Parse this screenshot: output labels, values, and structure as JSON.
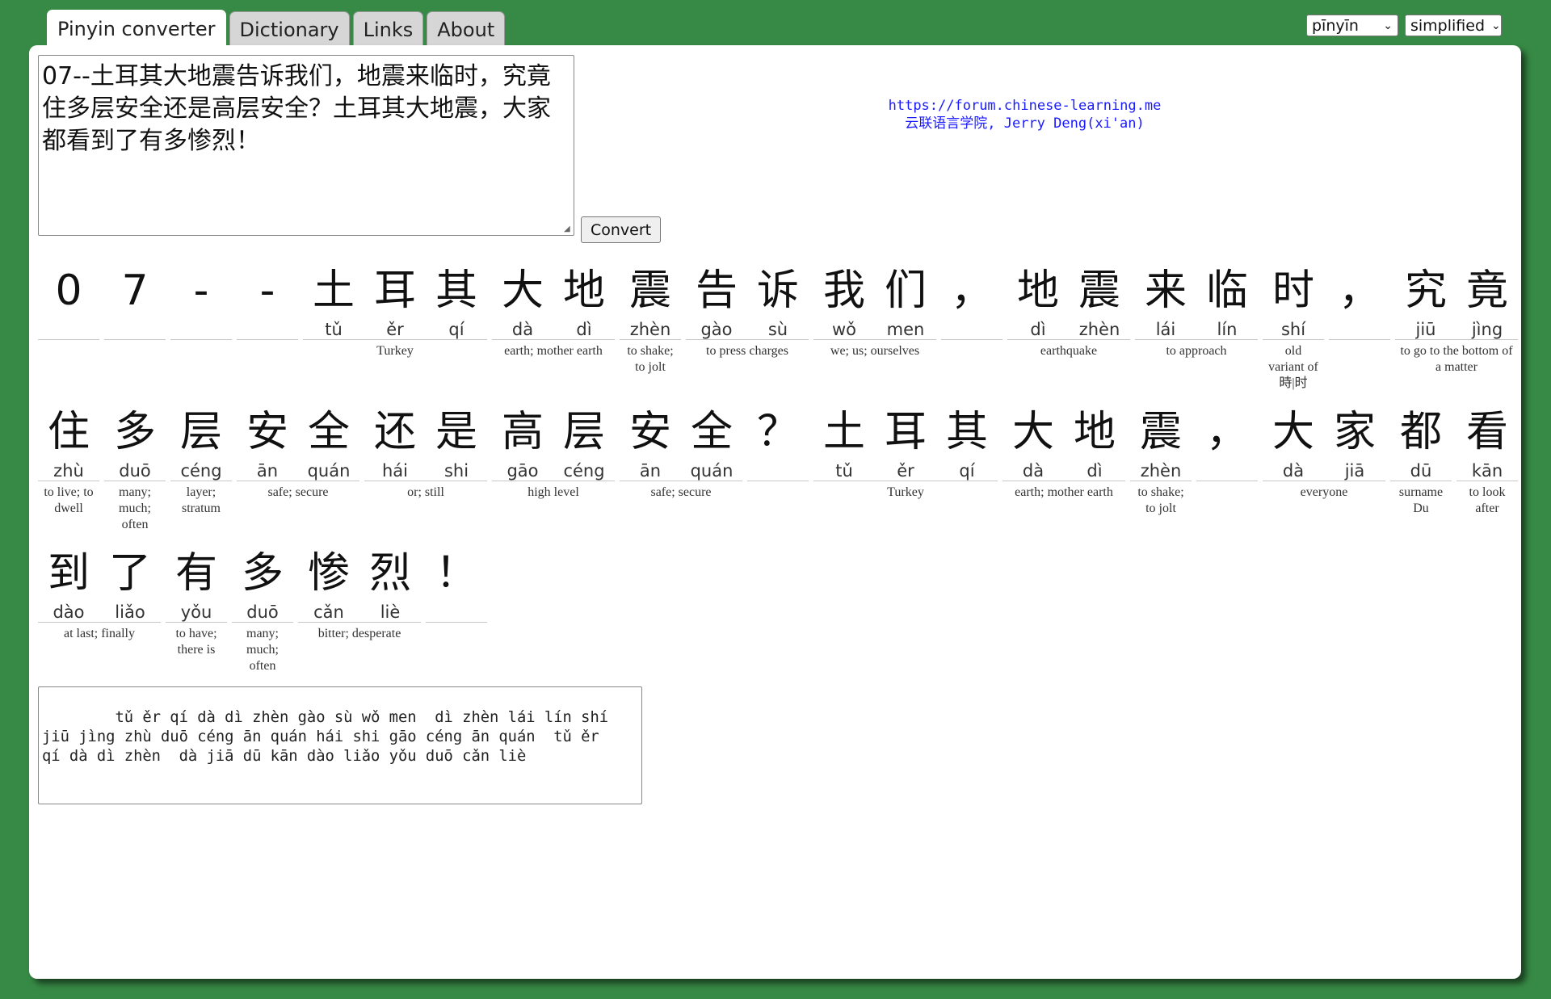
{
  "tabs": [
    {
      "label": "Pinyin converter",
      "active": true
    },
    {
      "label": "Dictionary",
      "active": false
    },
    {
      "label": "Links",
      "active": false
    },
    {
      "label": "About",
      "active": false
    }
  ],
  "selects": {
    "tone_style": "pīnyīn",
    "script": "simplified"
  },
  "input_text": "07--土耳其大地震告诉我们，地震来临时，究竟住多层安全还是高层安全？土耳其大地震，大家都看到了有多惨烈！",
  "convert_label": "Convert",
  "credit": {
    "url": "https://forum.chinese-learning.me",
    "author": "云联语言学院, Jerry Deng(xi'an)"
  },
  "rows": [
    [
      {
        "chars": [
          [
            "0",
            ""
          ]
        ],
        "def": ""
      },
      {
        "chars": [
          [
            "7",
            ""
          ]
        ],
        "def": ""
      },
      {
        "chars": [
          [
            "-",
            ""
          ]
        ],
        "def": ""
      },
      {
        "chars": [
          [
            "-",
            ""
          ]
        ],
        "def": ""
      },
      {
        "chars": [
          [
            "土",
            "tǔ"
          ],
          [
            "耳",
            "ěr"
          ],
          [
            "其",
            "qí"
          ]
        ],
        "def": "Turkey"
      },
      {
        "chars": [
          [
            "大",
            "dà"
          ],
          [
            "地",
            "dì"
          ]
        ],
        "def": "earth; mother earth"
      },
      {
        "chars": [
          [
            "震",
            "zhèn"
          ]
        ],
        "def": "to shake; to jolt"
      },
      {
        "chars": [
          [
            "告",
            "gào"
          ],
          [
            "诉",
            "sù"
          ]
        ],
        "def": "to press charges"
      },
      {
        "chars": [
          [
            "我",
            "wǒ"
          ],
          [
            "们",
            "men"
          ]
        ],
        "def": "we; us; ourselves"
      },
      {
        "chars": [
          [
            "，",
            ""
          ]
        ],
        "def": ""
      },
      {
        "chars": [
          [
            "地",
            "dì"
          ],
          [
            "震",
            "zhèn"
          ]
        ],
        "def": "earthquake"
      },
      {
        "chars": [
          [
            "来",
            "lái"
          ],
          [
            "临",
            "lín"
          ]
        ],
        "def": "to approach"
      },
      {
        "chars": [
          [
            "时",
            "shí"
          ]
        ],
        "def": "old variant of 時|时"
      },
      {
        "chars": [
          [
            "，",
            ""
          ]
        ],
        "def": ""
      },
      {
        "chars": [
          [
            "究",
            "jiū"
          ],
          [
            "竟",
            "jìng"
          ]
        ],
        "def": "to go to the bottom of a matter"
      }
    ],
    [
      {
        "chars": [
          [
            "住",
            "zhù"
          ]
        ],
        "def": "to live; to dwell"
      },
      {
        "chars": [
          [
            "多",
            "duō"
          ]
        ],
        "def": "many; much; often"
      },
      {
        "chars": [
          [
            "层",
            "céng"
          ]
        ],
        "def": "layer; stratum"
      },
      {
        "chars": [
          [
            "安",
            "ān"
          ],
          [
            "全",
            "quán"
          ]
        ],
        "def": "safe; secure"
      },
      {
        "chars": [
          [
            "还",
            "hái"
          ],
          [
            "是",
            "shi"
          ]
        ],
        "def": "or; still"
      },
      {
        "chars": [
          [
            "高",
            "gāo"
          ],
          [
            "层",
            "céng"
          ]
        ],
        "def": "high level"
      },
      {
        "chars": [
          [
            "安",
            "ān"
          ],
          [
            "全",
            "quán"
          ]
        ],
        "def": "safe; secure"
      },
      {
        "chars": [
          [
            "？",
            ""
          ]
        ],
        "def": ""
      },
      {
        "chars": [
          [
            "土",
            "tǔ"
          ],
          [
            "耳",
            "ěr"
          ],
          [
            "其",
            "qí"
          ]
        ],
        "def": "Turkey"
      },
      {
        "chars": [
          [
            "大",
            "dà"
          ],
          [
            "地",
            "dì"
          ]
        ],
        "def": "earth; mother earth"
      },
      {
        "chars": [
          [
            "震",
            "zhèn"
          ]
        ],
        "def": "to shake; to jolt"
      },
      {
        "chars": [
          [
            "，",
            ""
          ]
        ],
        "def": ""
      },
      {
        "chars": [
          [
            "大",
            "dà"
          ],
          [
            "家",
            "jiā"
          ]
        ],
        "def": "everyone"
      },
      {
        "chars": [
          [
            "都",
            "dū"
          ]
        ],
        "def": "surname Du"
      },
      {
        "chars": [
          [
            "看",
            "kān"
          ]
        ],
        "def": "to look after"
      }
    ],
    [
      {
        "chars": [
          [
            "到",
            "dào"
          ],
          [
            "了",
            "liǎo"
          ]
        ],
        "def": "at last; finally"
      },
      {
        "chars": [
          [
            "有",
            "yǒu"
          ]
        ],
        "def": "to have; there is"
      },
      {
        "chars": [
          [
            "多",
            "duō"
          ]
        ],
        "def": "many; much; often"
      },
      {
        "chars": [
          [
            "惨",
            "cǎn"
          ],
          [
            "烈",
            "liè"
          ]
        ],
        "def": "bitter; desperate"
      },
      {
        "chars": [
          [
            "！",
            ""
          ]
        ],
        "def": ""
      }
    ]
  ],
  "output_text": "    tǔ ěr qí dà dì zhèn gào sù wǒ men  dì zhèn lái lín shí\njiū jìng zhù duō céng ān quán hái shi gāo céng ān quán  tǔ ěr\nqí dà dì zhèn  dà jiā dū kān dào liǎo yǒu duō cǎn liè"
}
